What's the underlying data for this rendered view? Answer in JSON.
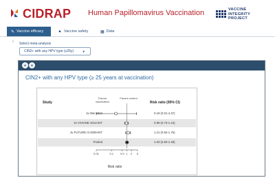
{
  "header": {
    "logo_text": "CIDRAP",
    "title": "Human Papillomavirus Vaccination",
    "badge_text": "VACCINE\nINTEGRITY\nPROJECT"
  },
  "tabs": [
    {
      "label": "Vaccine efficacy",
      "icon": "syringe-icon",
      "active": true
    },
    {
      "label": "Vaccine safety",
      "icon": "warning-icon",
      "active": false
    },
    {
      "label": "Data",
      "icon": "table-icon",
      "active": false
    }
  ],
  "filter": {
    "label": "Select meta-analysis",
    "value": "CIN2+ with any HPV type (≥25y)"
  },
  "panel": {
    "title": "CIN2+ with any HPV type (≥ 25 years at vaccination)"
  },
  "chart_data": {
    "type": "forest",
    "header_study": "Study",
    "header_rr": "Risk ratio (95% CI)",
    "favors_left": "Favors vaccination",
    "favors_right": "Favors control",
    "xlabel": "Risk ratio",
    "scale": "log",
    "ticks": [
      "0.01",
      "0.1",
      "0.5",
      "1",
      "2",
      "5"
    ],
    "tick_values": [
      0.01,
      0.1,
      0.5,
      1,
      2,
      5
    ],
    "rows": [
      {
        "study": "4v Wei 2024",
        "rr": 0.19,
        "lo": 0.01,
        "hi": 4.37,
        "ci_text": "0.19 (0.01-4.37)",
        "pooled": false
      },
      {
        "study": "2v VIVIANE 2014-INT",
        "rr": 0.95,
        "lo": 0.73,
        "hi": 1.24,
        "ci_text": "0.95 (0.73-1.24)",
        "pooled": false
      },
      {
        "study": "4v FUTURE III 2009-INT",
        "rr": 1.21,
        "lo": 0.84,
        "hi": 1.75,
        "ci_text": "1.21 (0.84-1.75)",
        "pooled": false
      },
      {
        "study": "Pooled",
        "rr": 1.03,
        "lo": 0.83,
        "hi": 1.28,
        "ci_text": "1.03 (0.83-1.28)",
        "pooled": true
      }
    ]
  }
}
